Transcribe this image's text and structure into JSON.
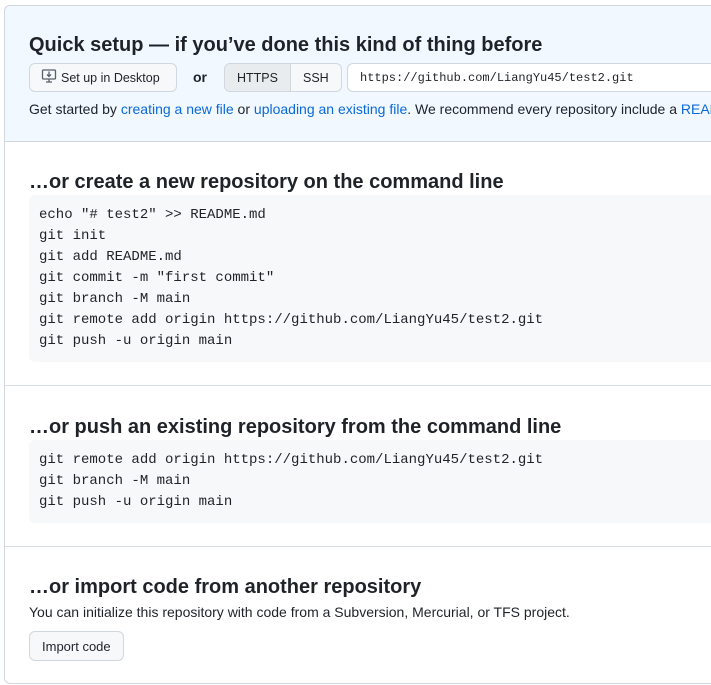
{
  "quick_setup": {
    "title": "Quick setup — if you’ve done this kind of thing before",
    "desktop_button": "Set up in Desktop",
    "or": "or",
    "protocols": [
      "HTTPS",
      "SSH"
    ],
    "selected_protocol": "HTTPS",
    "clone_url": "https://github.com/LiangYu45/test2.git",
    "get_started": {
      "prefix": "Get started by ",
      "link1": "creating a new file",
      "middle": " or ",
      "link2": "uploading an existing file",
      "suffix": ". We recommend every repository include a ",
      "link3": "README, LICENSE, and .gitignore"
    }
  },
  "create_section": {
    "title": "…or create a new repository on the command line",
    "lines": [
      "echo \"# test2\" >> README.md",
      "git init",
      "git add README.md",
      "git commit -m \"first commit\"",
      "git branch -M main",
      "git remote add origin https://github.com/LiangYu45/test2.git",
      "git push -u origin main"
    ]
  },
  "push_section": {
    "title": "…or push an existing repository from the command line",
    "lines": [
      "git remote add origin https://github.com/LiangYu45/test2.git",
      "git branch -M main",
      "git push -u origin main"
    ]
  },
  "import_section": {
    "title": "…or import code from another repository",
    "description": "You can initialize this repository with code from a Subversion, Mercurial, or TFS project.",
    "button": "Import code"
  },
  "icons": {
    "desktop": "desktop-download-icon"
  },
  "colors": {
    "link": "#0969da",
    "quick_bg": "#f1f8ff",
    "code_bg": "#f6f8fa",
    "border": "#d0d7de"
  }
}
